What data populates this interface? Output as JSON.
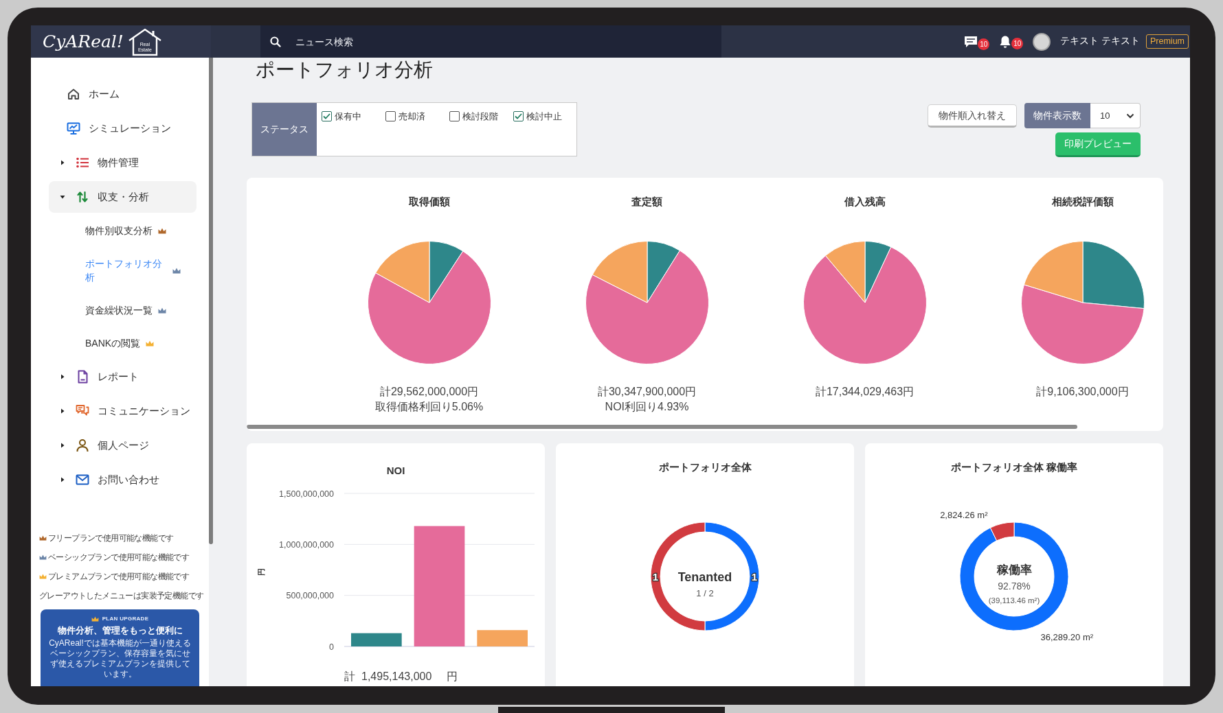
{
  "topbar": {
    "logo": {
      "text": "CyAReal!",
      "subtext": "Real Estate"
    },
    "search": {
      "placeholder": "ニュース検索"
    },
    "notifications": [
      {
        "kind": "chat",
        "badge": "10"
      },
      {
        "kind": "bell",
        "badge": "10"
      }
    ],
    "user": {
      "name": "テキスト テキスト",
      "plan": "Premium"
    }
  },
  "sidebar": {
    "items": [
      {
        "label": "ホーム",
        "selected": false
      },
      {
        "label": "シミュレーション",
        "selected": false
      },
      {
        "label": "物件管理",
        "selected": false,
        "expanded": false
      },
      {
        "label": "収支・分析",
        "selected": true,
        "expanded": true,
        "children": [
          {
            "label": "物件別収支分析",
            "selected": false,
            "color": "#b0682b"
          },
          {
            "label": "ポートフォリオ分析",
            "selected": true,
            "color": "#6d86a8"
          },
          {
            "label": "資金繰状況一覧",
            "selected": false,
            "color": "#6d86a8"
          },
          {
            "label": "BANKの閲覧",
            "selected": false,
            "color": "#f4b133"
          }
        ]
      },
      {
        "label": "レポート",
        "selected": false,
        "expanded": false
      },
      {
        "label": "コミュニケーション",
        "selected": false,
        "expanded": false
      },
      {
        "label": "個人ページ",
        "selected": false,
        "expanded": false
      },
      {
        "label": "お問い合わせ",
        "selected": false,
        "expanded": false
      }
    ],
    "plan_legend": [
      {
        "color": "#b0682b",
        "text": "フリープランで使用可能な機能です"
      },
      {
        "color": "#6d86a8",
        "text": "ベーシックプランで使用可能な機能です"
      },
      {
        "color": "#f4b133",
        "text": "プレミアムプランで使用可能な機能です"
      }
    ],
    "legend_note": "グレーアウトしたメニューは実装予定機能です",
    "promo": {
      "tag": "PLAN UPGRADE",
      "title": "物件分析、管理をもっと便利に",
      "text": "CyAReal!では基本機能が一通り使えるベーシックプラン、保存容量を気にせず使えるプレミアムプランを提供しています。"
    }
  },
  "page": {
    "title": "ポートフォリオ分析",
    "status_filter": {
      "label": "ステータス",
      "options": [
        {
          "label": "保有中",
          "checked": true
        },
        {
          "label": "売却済",
          "checked": false
        },
        {
          "label": "検討段階",
          "checked": false
        },
        {
          "label": "検討中止",
          "checked": true
        }
      ]
    },
    "sort_button": "物件順入れ替え",
    "display_count": {
      "label": "物件表示数",
      "value": "10"
    },
    "print_button": "印刷プレビュー"
  },
  "pie_charts": [
    {
      "title": "取得価額",
      "lines": [
        "計29,562,000,000円",
        "取得価格利回り5.06%"
      ]
    },
    {
      "title": "査定額",
      "lines": [
        "計30,347,900,000円",
        "NOI利回り4.93%"
      ]
    },
    {
      "title": "借入残高",
      "lines": [
        "計17,344,029,463円"
      ]
    },
    {
      "title": "相続税評価額",
      "lines": [
        "計9,106,300,000円"
      ]
    }
  ],
  "noi_card": {
    "chart_data": {
      "type": "bar",
      "title": "NOI",
      "ylabel": "円",
      "series": [
        {
          "color": "#2e878a",
          "values": [
            130000000
          ]
        },
        {
          "color": "#e56b9a",
          "values": [
            1180000000
          ]
        },
        {
          "color": "#f5a55d",
          "values": [
            160000000
          ]
        }
      ],
      "ylim": [
        0,
        1500000000
      ],
      "yticks": [
        {
          "value": 0,
          "label": "0"
        },
        {
          "value": 500000000,
          "label": "500,000,000"
        },
        {
          "value": 1000000000,
          "label": "1,000,000,000"
        },
        {
          "value": 1500000000,
          "label": "1,500,000,000"
        }
      ]
    },
    "total": {
      "label": "計",
      "value": "1,495,143,000",
      "unit": "円"
    }
  },
  "tenancy_card": {
    "chart_data": {
      "type": "donut",
      "title": "ポートフォリオ全体",
      "values": [
        1,
        1
      ],
      "colors": [
        "#0d6efd",
        "#d13b40"
      ],
      "data_labels": true
    },
    "center_label": "Tenanted",
    "center_value": "1 / 2"
  },
  "occupancy_card": {
    "chart_data": {
      "type": "donut",
      "title": "ポートフォリオ全体 稼働率",
      "values": [
        36289.2,
        2824.26
      ],
      "colors": [
        "#0d6efd",
        "#d13b40"
      ],
      "value_labels": [
        "36,289.20 m²",
        "2,824.26 m²"
      ]
    },
    "center_label": "稼働率",
    "center_value": "92.78%",
    "center_note": "(39,113.46 m²)"
  }
}
